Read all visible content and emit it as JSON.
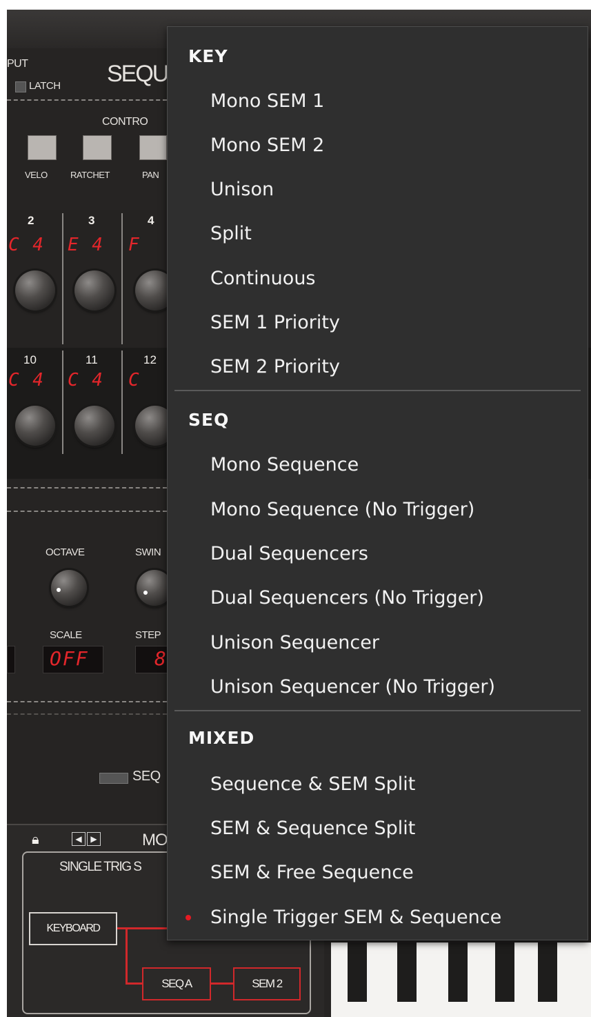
{
  "background_panel": {
    "labels": {
      "put": "PUT",
      "latch": "LATCH",
      "sequ": "SEQU",
      "contro": "CONTRO",
      "velo": "VELO",
      "ratchet": "RATCHET",
      "pan": "PAN",
      "octave": "OCTAVE",
      "swin": "SWIN",
      "scale": "SCALE",
      "step": "STEP",
      "seq": "SEQ",
      "mo": "MO",
      "single_trig": "SINGLE TRIG S"
    },
    "steps_row1": [
      {
        "num": "2",
        "led": "C 4"
      },
      {
        "num": "3",
        "led": "E 4"
      },
      {
        "num": "4",
        "led": "F"
      }
    ],
    "steps_row2": [
      {
        "num": "10",
        "led": "C 4"
      },
      {
        "num": "11",
        "led": "C 4"
      },
      {
        "num": "12",
        "led": "C"
      }
    ],
    "led_left": "C 4",
    "led_left2": "C 4",
    "scale_value": "OFF",
    "step_value": "8",
    "routing": {
      "keyboard": "KEYBOARD",
      "seq_a": "SEQ A",
      "sem_2": "SEM 2"
    }
  },
  "menu": {
    "sections": [
      {
        "header": "KEY",
        "items": [
          "Mono SEM 1",
          "Mono SEM 2",
          "Unison",
          "Split",
          "Continuous",
          "SEM 1 Priority",
          "SEM 2 Priority"
        ]
      },
      {
        "header": "SEQ",
        "items": [
          "Mono Sequence",
          "Mono Sequence (No Trigger)",
          "Dual Sequencers",
          "Dual Sequencers (No Trigger)",
          "Unison Sequencer",
          "Unison Sequencer (No Trigger)"
        ]
      },
      {
        "header": "MIXED",
        "items": [
          "Sequence & SEM Split",
          "SEM & Sequence Split",
          "SEM & Free Sequence",
          "Single Trigger SEM & Sequence"
        ]
      }
    ],
    "selected_item": "Single Trigger SEM & Sequence",
    "selected_color": "#e51b23"
  }
}
